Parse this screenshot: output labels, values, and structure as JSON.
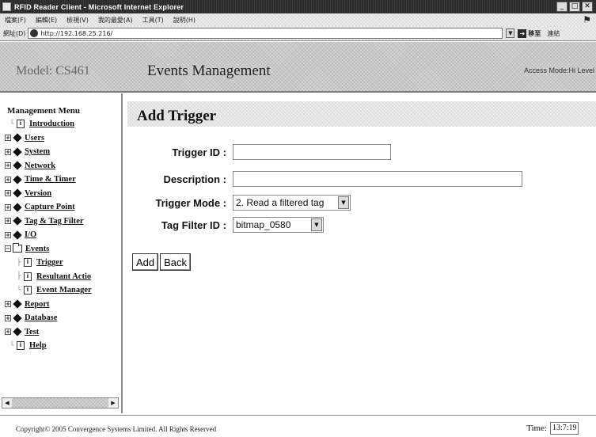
{
  "window": {
    "title": "RFID Reader Client - Microsoft Internet Explorer",
    "buttons": {
      "minimize": "_",
      "maximize": "□",
      "close": "✕"
    }
  },
  "menubar": {
    "items": [
      "檔案(F)",
      "編輯(E)",
      "檢視(V)",
      "我的最愛(A)",
      "工具(T)",
      "說明(H)"
    ]
  },
  "addressbar": {
    "label": "網址(D)",
    "url": "http://192.168.25.216/",
    "go_label": "移至",
    "links_label": "連結"
  },
  "header": {
    "model": "Model: CS461",
    "title": "Events Management",
    "access": "Access Mode:Hi Level"
  },
  "sidebar": {
    "heading": "Management Menu",
    "items": {
      "introduction": "Introduction",
      "users": "Users",
      "system": "System",
      "network": "Network",
      "time_timer": "Time & Timer",
      "version": "Version",
      "capture_point": "Capture Point",
      "tag_filter": "Tag & Tag Filter",
      "io": "I/O",
      "events": "Events",
      "trigger": "Trigger",
      "resultant_action": "Resultant Actio",
      "event_manager": "Event Manager",
      "report": "Report",
      "database": "Database",
      "test": "Test",
      "help": "Help"
    }
  },
  "main": {
    "page_title": "Add Trigger",
    "form": {
      "trigger_id_label": "Trigger ID :",
      "trigger_id_value": "",
      "description_label": "Description :",
      "description_value": "",
      "trigger_mode_label": "Trigger Mode :",
      "trigger_mode_value": "2. Read a filtered tag",
      "tag_filter_id_label": "Tag Filter ID :",
      "tag_filter_id_value": "bitmap_0580"
    },
    "buttons": {
      "add": "Add",
      "back": "Back"
    }
  },
  "footer": {
    "copyright": "Copyright© 2005 Convergence Systems Limited. All Rights Reserved",
    "time_label": "Time:",
    "time_value": "13:7:19"
  }
}
